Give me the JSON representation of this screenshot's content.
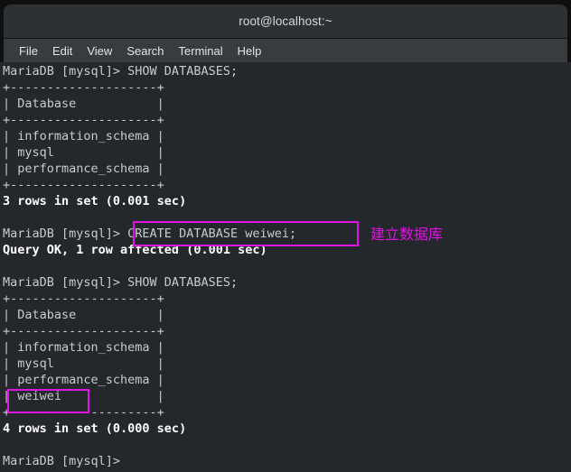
{
  "window": {
    "title": "root@localhost:~"
  },
  "menubar": {
    "items": [
      {
        "label": "File",
        "name": "menu-file"
      },
      {
        "label": "Edit",
        "name": "menu-edit"
      },
      {
        "label": "View",
        "name": "menu-view"
      },
      {
        "label": "Search",
        "name": "menu-search"
      },
      {
        "label": "Terminal",
        "name": "menu-terminal"
      },
      {
        "label": "Help",
        "name": "menu-help"
      }
    ]
  },
  "terminal": {
    "prompt": "MariaDB [mysql]>",
    "session": [
      {
        "type": "prompt",
        "text": "MariaDB [mysql]> SHOW DATABASES;"
      },
      {
        "type": "output",
        "text": "+--------------------+"
      },
      {
        "type": "output",
        "text": "| Database           |"
      },
      {
        "type": "output",
        "text": "+--------------------+"
      },
      {
        "type": "output",
        "text": "| information_schema |"
      },
      {
        "type": "output",
        "text": "| mysql              |"
      },
      {
        "type": "output",
        "text": "| performance_schema |"
      },
      {
        "type": "output",
        "text": "+--------------------+"
      },
      {
        "type": "result",
        "text": "3 rows in set (0.001 sec)"
      },
      {
        "type": "blank",
        "text": ""
      },
      {
        "type": "prompt",
        "text": "MariaDB [mysql]> CREATE DATABASE weiwei;"
      },
      {
        "type": "result",
        "text": "Query OK, 1 row affected (0.001 sec)"
      },
      {
        "type": "blank",
        "text": ""
      },
      {
        "type": "prompt",
        "text": "MariaDB [mysql]> SHOW DATABASES;"
      },
      {
        "type": "output",
        "text": "+--------------------+"
      },
      {
        "type": "output",
        "text": "| Database           |"
      },
      {
        "type": "output",
        "text": "+--------------------+"
      },
      {
        "type": "output",
        "text": "| information_schema |"
      },
      {
        "type": "output",
        "text": "| mysql              |"
      },
      {
        "type": "output",
        "text": "| performance_schema |"
      },
      {
        "type": "output",
        "text": "| weiwei             |"
      },
      {
        "type": "output",
        "text": "+--------------------+"
      },
      {
        "type": "result",
        "text": "4 rows in set (0.000 sec)"
      },
      {
        "type": "blank",
        "text": ""
      },
      {
        "type": "prompt",
        "text": "MariaDB [mysql]>"
      }
    ],
    "commands": [
      "SHOW DATABASES;",
      "CREATE DATABASE weiwei;",
      "SHOW DATABASES;"
    ],
    "tables": [
      {
        "header": "Database",
        "rows": [
          "information_schema",
          "mysql",
          "performance_schema"
        ],
        "row_count_text": "3 rows in set (0.001 sec)"
      },
      {
        "header": "Database",
        "rows": [
          "information_schema",
          "mysql",
          "performance_schema",
          "weiwei"
        ],
        "row_count_text": "4 rows in set (0.000 sec)"
      }
    ],
    "query_ok_text": "Query OK, 1 row affected (0.001 sec)"
  },
  "annotations": {
    "color": "#e014e0",
    "highlight_create_command": "CREATE DATABASE weiwei;",
    "highlight_database_name": "weiwei",
    "label_create": "建立数据库"
  },
  "colors": {
    "terminal_background": "#24272b",
    "terminal_foreground": "#c8cccf",
    "terminal_bold": "#ffffff",
    "titlebar_background": "#2e3134",
    "menubar_background": "#383c40",
    "annotation": "#e014e0"
  }
}
